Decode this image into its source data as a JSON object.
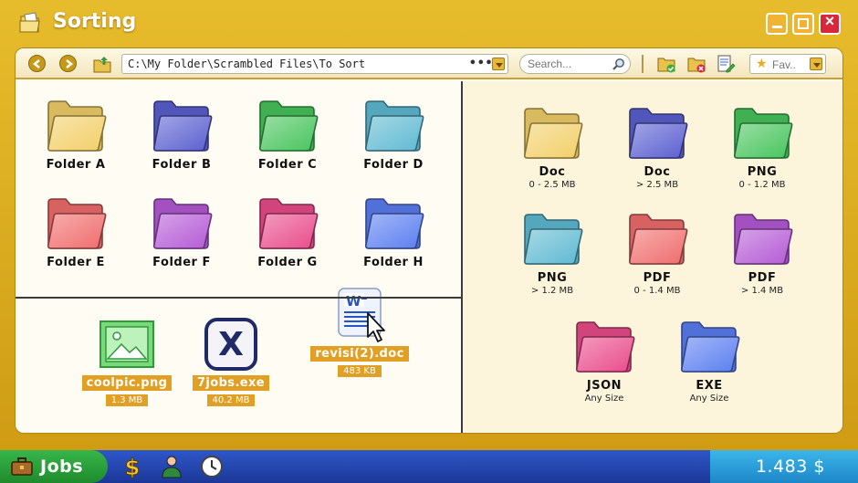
{
  "window": {
    "title": "Sorting",
    "title_icon": "folder-document-icon",
    "buttons": {
      "minimize": "minimize-icon",
      "maximize": "maximize-icon",
      "close": "×"
    }
  },
  "toolbar": {
    "back_icon": "arrow-left-icon",
    "forward_icon": "arrow-right-icon",
    "up_icon": "folder-up-icon",
    "path": "C:\\My Folder\\Scrambled Files\\To Sort",
    "path_more": "•••",
    "search_placeholder": "Search...",
    "favorites_label": "Fav..",
    "icons": [
      "folder-check-icon",
      "folder-delete-icon",
      "document-edit-icon"
    ]
  },
  "folders_left": [
    {
      "name": "Folder A",
      "color": "#f2cf68"
    },
    {
      "name": "Folder B",
      "color": "#5a5fd0"
    },
    {
      "name": "Folder C",
      "color": "#47c45c"
    },
    {
      "name": "Folder D",
      "color": "#5eb9d2"
    },
    {
      "name": "Folder E",
      "color": "#f06c6c"
    },
    {
      "name": "Folder F",
      "color": "#b55ad6"
    },
    {
      "name": "Folder G",
      "color": "#e94b8a"
    },
    {
      "name": "Folder H",
      "color": "#5a7ef0"
    }
  ],
  "files": [
    {
      "name": "coolpic.png",
      "size": "1.3 MB",
      "icon": "image-file-icon"
    },
    {
      "name": "7jobs.exe",
      "size": "40.2 MB",
      "icon": "exe-x-icon"
    },
    {
      "name": "revisi(2).doc",
      "size": "483 KB",
      "icon": "word-document-icon"
    }
  ],
  "folders_right": [
    {
      "name": "Doc",
      "rule": "0 - 2.5 MB",
      "color": "#f2cf68"
    },
    {
      "name": "Doc",
      "rule": "> 2.5 MB",
      "color": "#5a5fd0"
    },
    {
      "name": "PNG",
      "rule": "0 - 1.2 MB",
      "color": "#47c45c"
    },
    {
      "name": "PNG",
      "rule": "> 1.2 MB",
      "color": "#5eb9d2"
    },
    {
      "name": "PDF",
      "rule": "0 - 1.4 MB",
      "color": "#f06c6c"
    },
    {
      "name": "PDF",
      "rule": "> 1.4 MB",
      "color": "#b55ad6"
    },
    {
      "name": "JSON",
      "rule": "Any Size",
      "color": "#e94b8a"
    },
    {
      "name": "EXE",
      "rule": "Any Size",
      "color": "#5a7ef0"
    }
  ],
  "taskbar": {
    "start_label": "Jobs",
    "start_icon": "briefcase-icon",
    "tray_icons": [
      "dollar-icon",
      "person-icon",
      "clock-icon"
    ],
    "money": "1.483 $"
  },
  "cursor_icon": "pointer-cursor-icon"
}
